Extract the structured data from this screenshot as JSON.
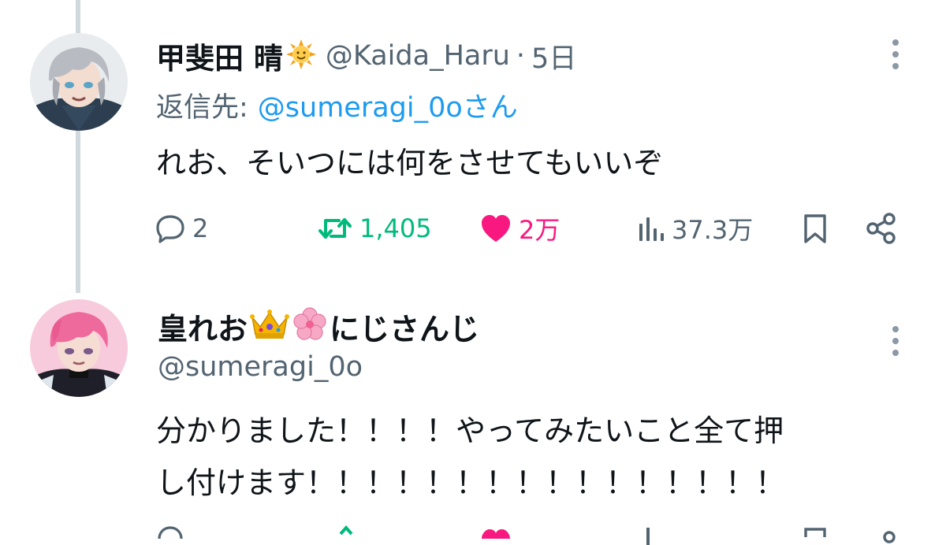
{
  "tweet1": {
    "display_name": "甲斐田 晴",
    "name_emoji": "sun-face-emoji",
    "handle": "@Kaida_Haru",
    "separator": "·",
    "time": "5日",
    "reply_label": "返信先:",
    "reply_mention": "@sumeragi_0oさん",
    "text": "れお、そいつには何をさせてもいいぞ",
    "replies": "2",
    "retweets": "1,405",
    "likes": "2万",
    "views": "37.3万",
    "retweeted": true,
    "liked": true
  },
  "tweet2": {
    "display_name_part1": "皇れお",
    "name_emojis": [
      "crown-emoji",
      "cherry-blossom-emoji"
    ],
    "display_name_part2": "にじさんじ",
    "handle": "@sumeragi_0o",
    "text_line1": "分かりました！！！！やってみたいこと全て押",
    "text_line2": "し付けます！！！！！！！！！！！！！！！！"
  },
  "colors": {
    "text": "#0f1419",
    "secondary": "#536471",
    "link": "#1d9bf0",
    "retweet": "#00ba7c",
    "like": "#f91880",
    "thread_line": "#cfd9de"
  },
  "icons": [
    "reply-icon",
    "retweet-icon",
    "like-icon",
    "views-icon",
    "bookmark-icon",
    "share-icon",
    "more-icon"
  ]
}
